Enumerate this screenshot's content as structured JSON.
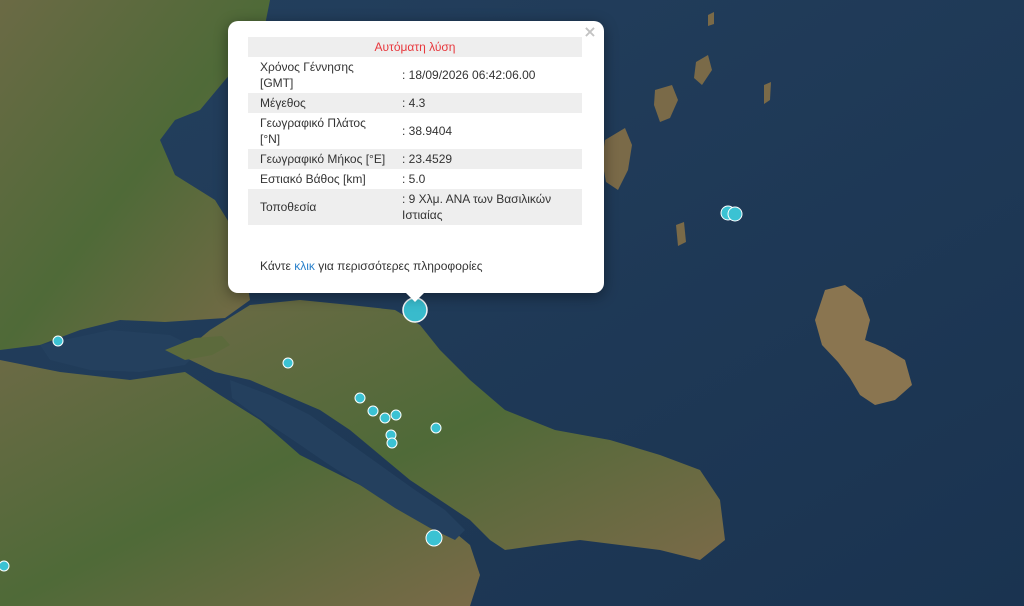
{
  "popup": {
    "title": "Αυτόματη λύση",
    "close_label": "×",
    "rows": [
      {
        "label": "Χρόνος Γέννησης [GMT]",
        "value": ": 18/09/2026 06:42:06.00"
      },
      {
        "label": "Μέγεθος",
        "value": ": 4.3"
      },
      {
        "label": "Γεωγραφικό Πλάτος [°N]",
        "value": ": 38.9404"
      },
      {
        "label": "Γεωγραφικό Μήκος [°E]",
        "value": ": 23.4529"
      },
      {
        "label": "Εστιακό Βάθος [km]",
        "value": ": 5.0"
      },
      {
        "label": "Τοποθεσία",
        "value": ": 9 Χλμ. ΑΝΑ των Βασιλικών Ιστιαίας"
      }
    ],
    "more_prefix": "Κάντε ",
    "more_link": "κλικ",
    "more_suffix": " για περισσότερες πληροφορίες"
  },
  "colors": {
    "sea": "#1f3a57",
    "land": "#5a6b3a",
    "marker": "#3bc2d3",
    "title_red": "#e8383d",
    "link_blue": "#2a81cb"
  }
}
